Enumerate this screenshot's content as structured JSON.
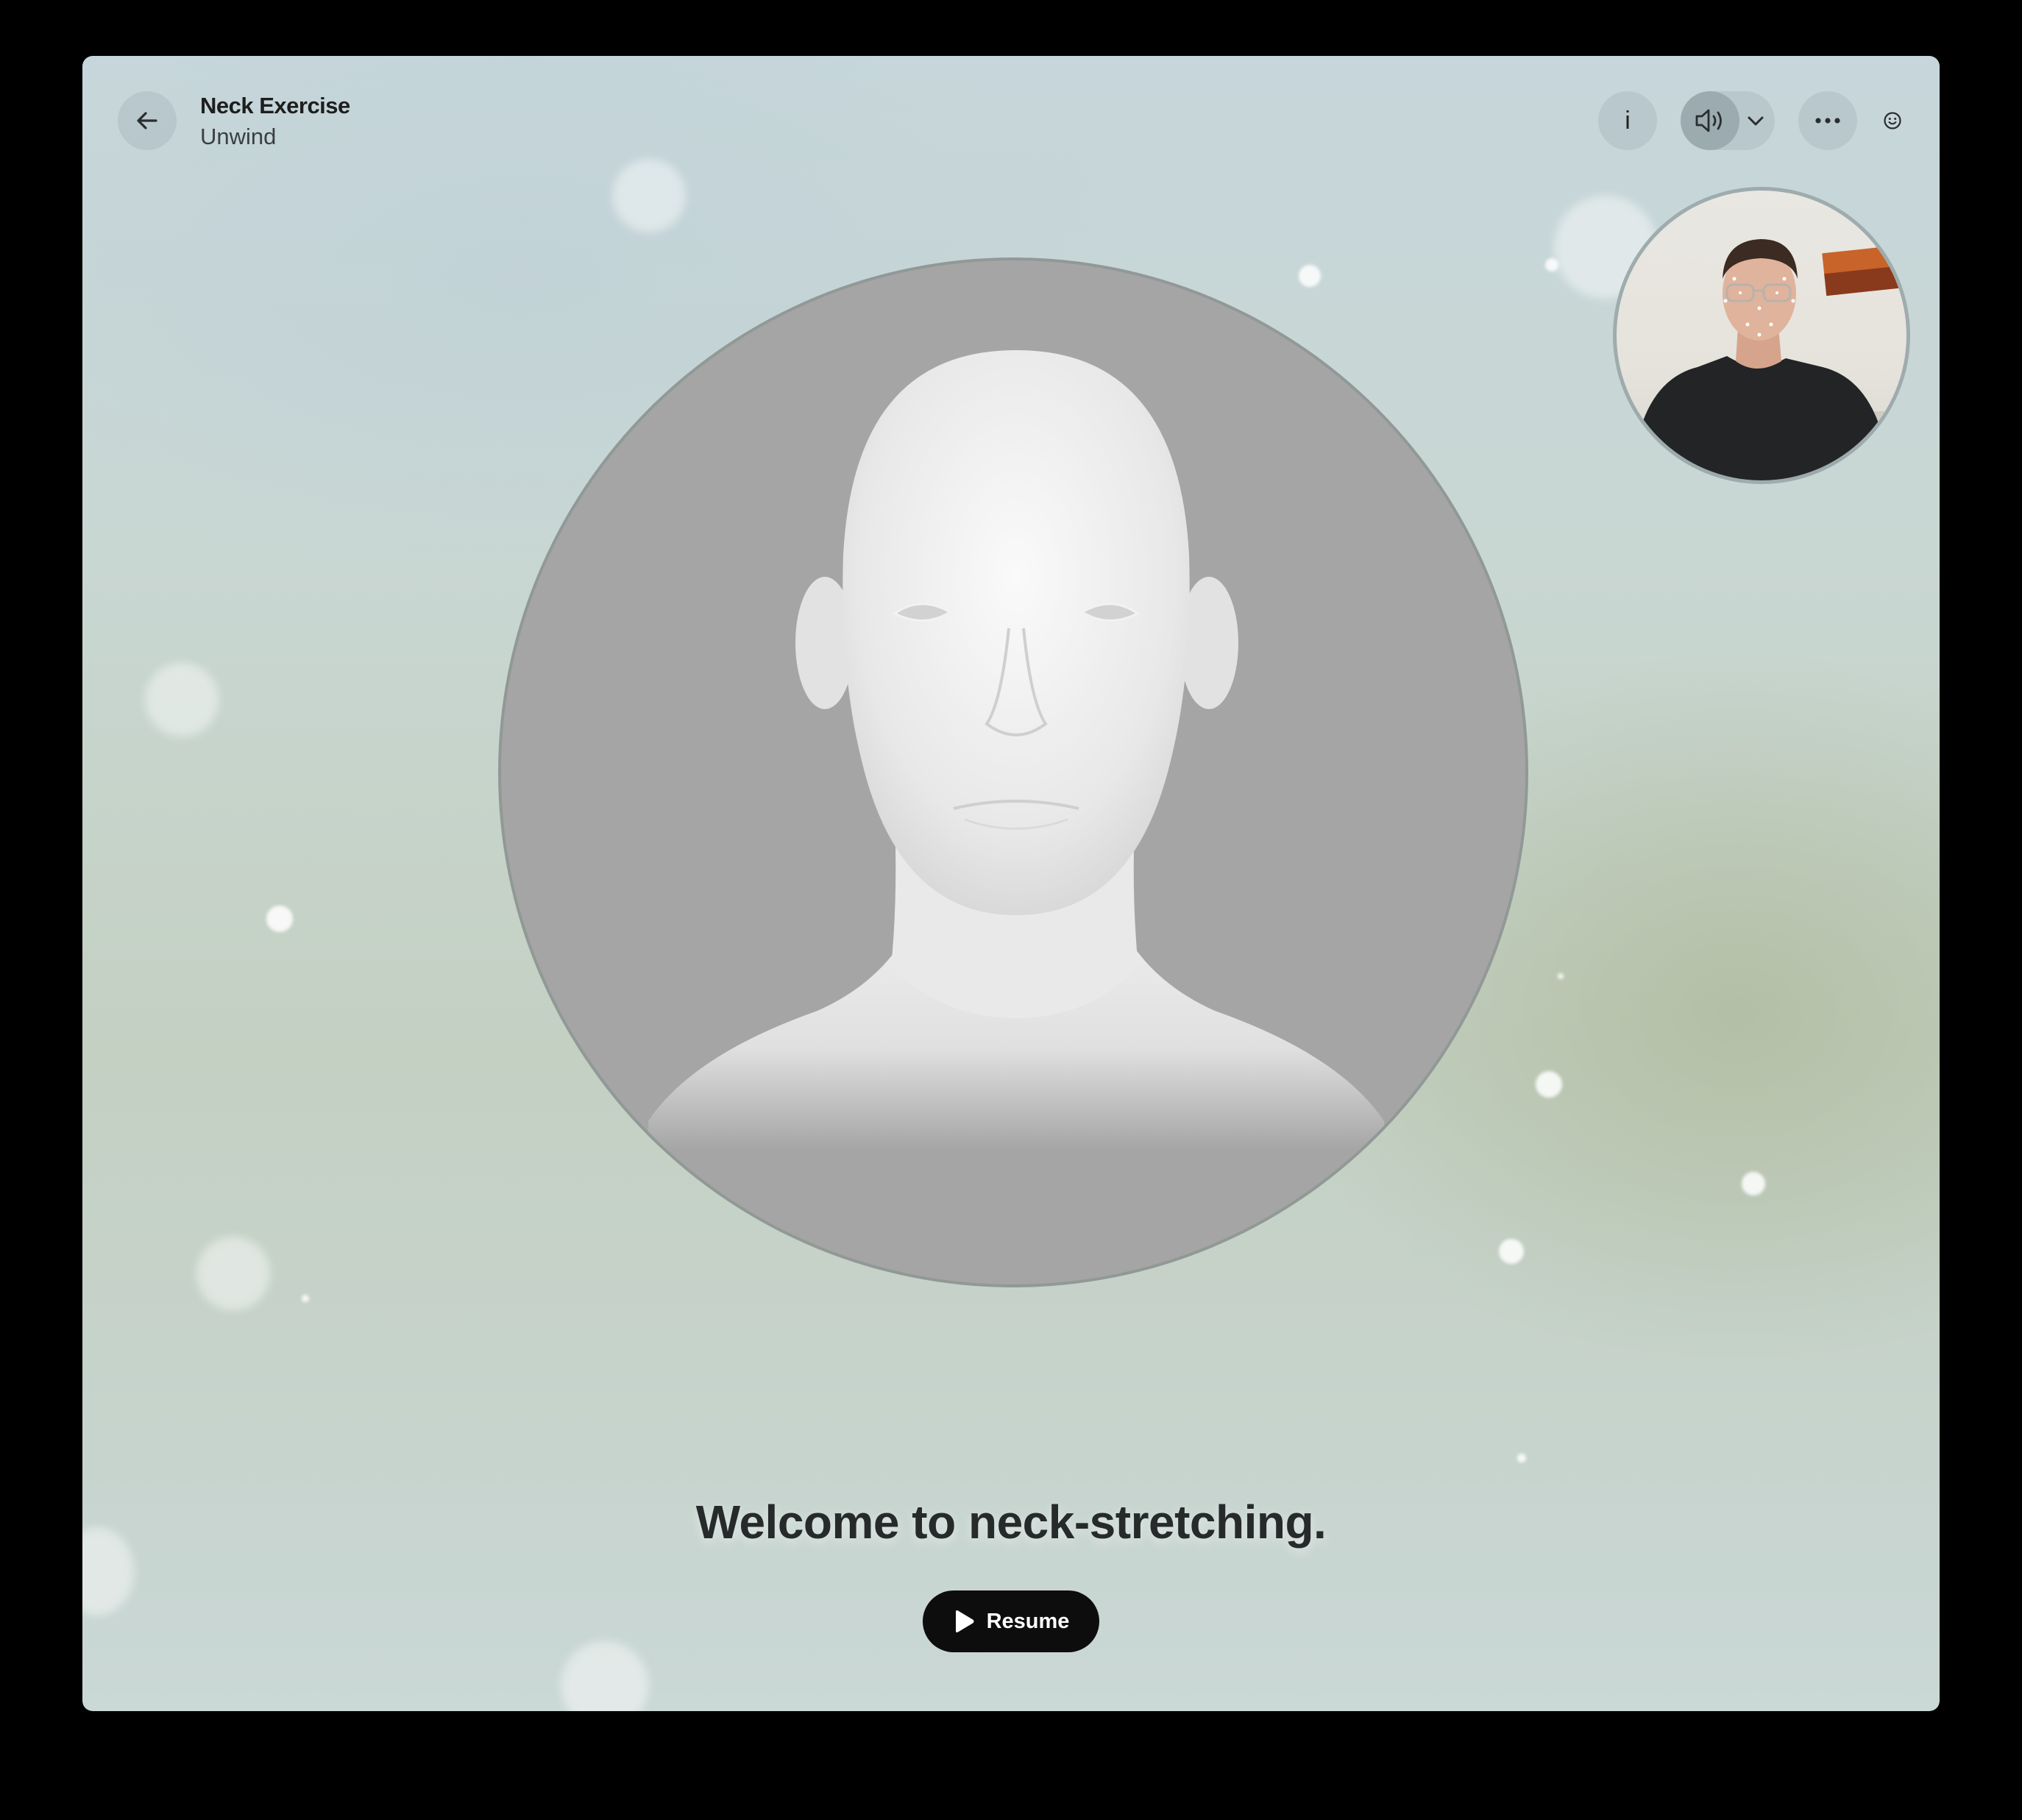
{
  "header": {
    "title": "Neck Exercise",
    "subtitle": "Unwind",
    "info_label": "i"
  },
  "icons": {
    "back": "arrow-left-icon",
    "info": "info-icon",
    "sound": "speaker-icon",
    "sound_menu": "chevron-down-icon",
    "more": "ellipsis-icon",
    "face": "smiley-icon",
    "resume": "play-icon"
  },
  "main": {
    "welcome_text": "Welcome to neck-stretching.",
    "resume_label": "Resume"
  }
}
